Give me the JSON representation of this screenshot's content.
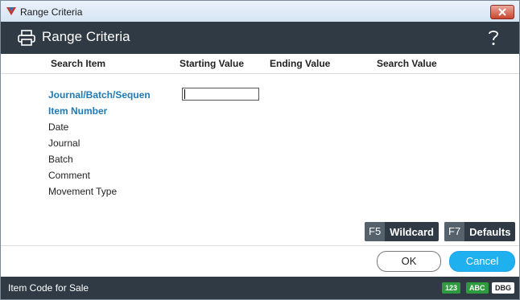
{
  "window": {
    "title": "Range Criteria"
  },
  "header": {
    "title": "Range Criteria",
    "help_symbol": "?"
  },
  "columns": [
    "Search Item",
    "Starting Value",
    "Ending Value",
    "Search Value"
  ],
  "search_items": [
    {
      "label": "Journal/Batch/Sequen",
      "active": true
    },
    {
      "label": "Item Number",
      "active": true
    },
    {
      "label": "Date",
      "active": false
    },
    {
      "label": "Journal",
      "active": false
    },
    {
      "label": "Batch",
      "active": false
    },
    {
      "label": "Comment",
      "active": false
    },
    {
      "label": "Movement Type",
      "active": false
    }
  ],
  "starting_value_input": {
    "value": ""
  },
  "function_keys": [
    {
      "key": "F5",
      "label": "Wildcard"
    },
    {
      "key": "F7",
      "label": "Defaults"
    }
  ],
  "buttons": {
    "ok": "OK",
    "cancel": "Cancel"
  },
  "status": {
    "text": "Item Code for Sale",
    "badges": [
      "123",
      "ABC",
      "DBG"
    ]
  },
  "colors": {
    "header_bg": "#2f3a44",
    "accent_blue": "#1fb0f0",
    "active_text": "#1f7ab6",
    "badge_green": "#2e9b3e"
  }
}
